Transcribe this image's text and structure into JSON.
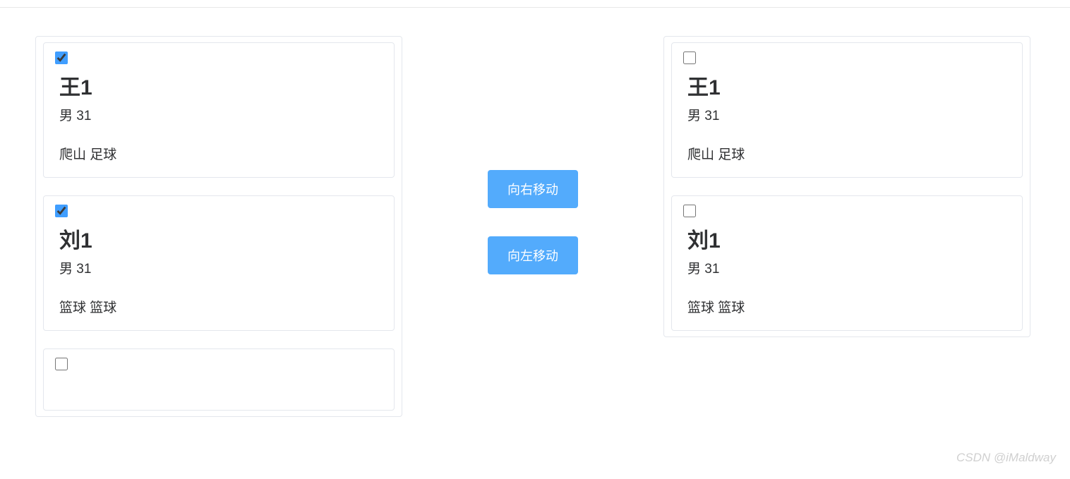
{
  "leftPanel": {
    "items": [
      {
        "checked": true,
        "name": "王1",
        "gender": "男",
        "age": "31",
        "tags": "爬山 足球"
      },
      {
        "checked": true,
        "name": "刘1",
        "gender": "男",
        "age": "31",
        "tags": "篮球 篮球"
      },
      {
        "checked": false,
        "name": "",
        "gender": "",
        "age": "",
        "tags": ""
      }
    ]
  },
  "rightPanel": {
    "items": [
      {
        "checked": false,
        "name": "王1",
        "gender": "男",
        "age": "31",
        "tags": "爬山 足球"
      },
      {
        "checked": false,
        "name": "刘1",
        "gender": "男",
        "age": "31",
        "tags": "篮球 篮球"
      }
    ]
  },
  "buttons": {
    "moveRight": "向右移动",
    "moveLeft": "向左移动"
  },
  "watermark": "CSDN @iMaldway"
}
